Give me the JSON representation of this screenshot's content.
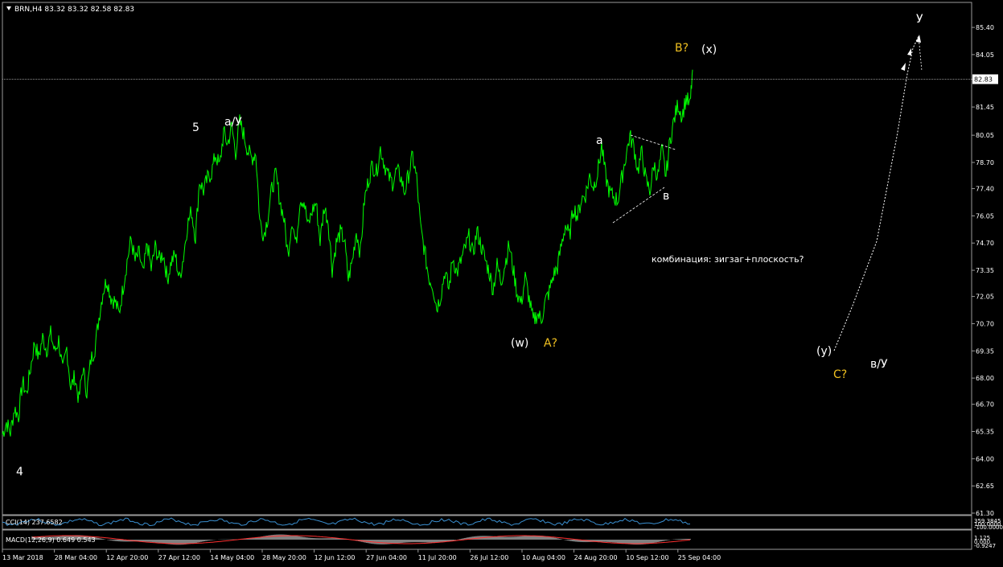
{
  "header": {
    "title": "BRN,H4  83.32 83.32 82.58 82.83",
    "arrow_icon": "triangle-down-icon"
  },
  "current_price": "82.83",
  "colors": {
    "background": "#000000",
    "price_line": "#00ff00",
    "text": "#ffffff",
    "accent_wave": "#f0c020",
    "grid_axis": "#aaaaaa",
    "macd_bar": "#aaaaaa",
    "macd_signal": "#ff3030",
    "cci_line": "#3a8fd0"
  },
  "chart_data": {
    "type": "line",
    "symbol": "BRN",
    "timeframe": "H4",
    "ylim": [
      61.3,
      86.6
    ],
    "y_ticks": [
      "85.40",
      "84.05",
      "82.83",
      "81.45",
      "80.05",
      "78.70",
      "77.40",
      "76.05",
      "74.70",
      "73.35",
      "72.05",
      "70.70",
      "69.35",
      "68.00",
      "66.70",
      "65.35",
      "64.00",
      "62.65",
      "61.30"
    ],
    "x_ticks": [
      "13 Mar 2018",
      "28 Mar 04:00",
      "12 Apr 20:00",
      "27 Apr 12:00",
      "14 May 04:00",
      "28 May 20:00",
      "12 Jun 12:00",
      "27 Jun 04:00",
      "11 Jul 20:00",
      "26 Jul 12:00",
      "10 Aug 04:00",
      "24 Aug 20:00",
      "10 Sep 12:00",
      "25 Sep 04:00"
    ],
    "series": [
      {
        "points": [
          [
            0,
            65.2
          ],
          [
            5,
            65.8
          ],
          [
            10,
            65.3
          ],
          [
            15,
            66.5
          ],
          [
            20,
            66.1
          ],
          [
            25,
            67.8
          ],
          [
            30,
            67.2
          ],
          [
            35,
            68.5
          ],
          [
            40,
            69.8
          ],
          [
            45,
            69.0
          ],
          [
            50,
            70.0
          ],
          [
            55,
            69.4
          ],
          [
            60,
            70.2
          ],
          [
            65,
            69.3
          ],
          [
            70,
            69.9
          ],
          [
            75,
            68.3
          ],
          [
            80,
            69.5
          ],
          [
            85,
            67.5
          ],
          [
            90,
            68.1
          ],
          [
            95,
            66.9
          ],
          [
            100,
            68.5
          ],
          [
            105,
            67.3
          ],
          [
            110,
            68.9
          ],
          [
            115,
            69.5
          ],
          [
            120,
            71.0
          ],
          [
            125,
            72.3
          ],
          [
            130,
            72.9
          ],
          [
            135,
            72.0
          ],
          [
            140,
            71.8
          ],
          [
            145,
            71.2
          ],
          [
            150,
            72.5
          ],
          [
            155,
            73.8
          ],
          [
            160,
            74.9
          ],
          [
            165,
            73.8
          ],
          [
            170,
            74.2
          ],
          [
            175,
            73.1
          ],
          [
            180,
            74.7
          ],
          [
            185,
            73.4
          ],
          [
            190,
            74.5
          ],
          [
            195,
            73.9
          ],
          [
            200,
            74.2
          ],
          [
            205,
            72.9
          ],
          [
            210,
            73.8
          ],
          [
            215,
            74.1
          ],
          [
            220,
            72.9
          ],
          [
            225,
            74.0
          ],
          [
            230,
            75.6
          ],
          [
            235,
            76.3
          ],
          [
            240,
            75.0
          ],
          [
            245,
            77.8
          ],
          [
            250,
            77.3
          ],
          [
            255,
            77.9
          ],
          [
            260,
            78.2
          ],
          [
            265,
            79.1
          ],
          [
            270,
            78.5
          ],
          [
            275,
            80.2
          ],
          [
            280,
            79.6
          ],
          [
            285,
            80.5
          ],
          [
            290,
            79.2
          ],
          [
            295,
            80.7
          ],
          [
            300,
            80.1
          ],
          [
            305,
            79.3
          ],
          [
            310,
            78.9
          ],
          [
            315,
            79.2
          ],
          [
            320,
            75.8
          ],
          [
            325,
            75.1
          ],
          [
            330,
            76.0
          ],
          [
            335,
            77.4
          ],
          [
            340,
            78.1
          ],
          [
            345,
            76.8
          ],
          [
            350,
            75.9
          ],
          [
            355,
            74.1
          ],
          [
            360,
            75.9
          ],
          [
            365,
            74.6
          ],
          [
            370,
            76.9
          ],
          [
            375,
            76.8
          ],
          [
            380,
            75.5
          ],
          [
            385,
            76.3
          ],
          [
            390,
            76.7
          ],
          [
            395,
            74.8
          ],
          [
            400,
            76.5
          ],
          [
            405,
            75.8
          ],
          [
            410,
            73.4
          ],
          [
            415,
            74.7
          ],
          [
            420,
            75.2
          ],
          [
            425,
            74.9
          ],
          [
            430,
            72.9
          ],
          [
            435,
            73.8
          ],
          [
            440,
            75.3
          ],
          [
            445,
            74.2
          ],
          [
            450,
            76.8
          ],
          [
            455,
            77.8
          ],
          [
            460,
            78.6
          ],
          [
            465,
            78.2
          ],
          [
            470,
            79.4
          ],
          [
            475,
            78.6
          ],
          [
            480,
            78.0
          ],
          [
            485,
            77.7
          ],
          [
            490,
            78.3
          ],
          [
            495,
            78.0
          ],
          [
            500,
            77.2
          ],
          [
            505,
            78.1
          ],
          [
            510,
            79.0
          ],
          [
            515,
            77.9
          ],
          [
            520,
            75.4
          ],
          [
            525,
            74.3
          ],
          [
            530,
            73.0
          ],
          [
            535,
            72.6
          ],
          [
            540,
            71.5
          ],
          [
            545,
            72.1
          ],
          [
            550,
            73.3
          ],
          [
            555,
            72.4
          ],
          [
            560,
            74.0
          ],
          [
            565,
            73.2
          ],
          [
            570,
            73.8
          ],
          [
            575,
            74.4
          ],
          [
            580,
            75.0
          ],
          [
            585,
            74.1
          ],
          [
            590,
            75.3
          ],
          [
            595,
            74.6
          ],
          [
            600,
            73.9
          ],
          [
            605,
            73.3
          ],
          [
            610,
            72.4
          ],
          [
            615,
            73.6
          ],
          [
            620,
            72.8
          ],
          [
            625,
            73.7
          ],
          [
            630,
            74.6
          ],
          [
            635,
            73.4
          ],
          [
            640,
            72.2
          ],
          [
            645,
            71.7
          ],
          [
            650,
            73.0
          ],
          [
            655,
            71.9
          ],
          [
            660,
            70.8
          ],
          [
            665,
            71.2
          ],
          [
            670,
            70.9
          ],
          [
            675,
            71.8
          ],
          [
            680,
            72.3
          ],
          [
            685,
            73.1
          ],
          [
            690,
            73.5
          ],
          [
            695,
            74.6
          ],
          [
            700,
            75.6
          ],
          [
            705,
            75.0
          ],
          [
            710,
            76.5
          ],
          [
            715,
            76.0
          ],
          [
            720,
            76.9
          ],
          [
            725,
            77.1
          ],
          [
            730,
            78.0
          ],
          [
            735,
            77.5
          ],
          [
            740,
            78.2
          ],
          [
            745,
            79.5
          ],
          [
            750,
            78.0
          ],
          [
            755,
            77.2
          ],
          [
            760,
            77.0
          ],
          [
            765,
            76.8
          ],
          [
            770,
            77.9
          ],
          [
            775,
            79.0
          ],
          [
            780,
            80.0
          ],
          [
            785,
            79.5
          ],
          [
            790,
            78.3
          ],
          [
            795,
            79.2
          ],
          [
            800,
            77.8
          ],
          [
            805,
            77.3
          ],
          [
            810,
            78.6
          ],
          [
            815,
            78.0
          ],
          [
            820,
            79.3
          ],
          [
            825,
            78.0
          ],
          [
            830,
            79.8
          ],
          [
            835,
            80.8
          ],
          [
            840,
            81.6
          ],
          [
            845,
            81.0
          ],
          [
            850,
            81.9
          ],
          [
            855,
            81.5
          ],
          [
            858,
            83.3
          ]
        ]
      }
    ],
    "annotations": [
      {
        "text": "4",
        "style": "white"
      },
      {
        "text": "5",
        "style": "white"
      },
      {
        "text": "a/У",
        "style": "white"
      },
      {
        "text": "а",
        "style": "white"
      },
      {
        "text": "в",
        "style": "white"
      },
      {
        "text": "B?",
        "style": "yellow"
      },
      {
        "text": "(x)",
        "style": "white"
      },
      {
        "text": "(w)",
        "style": "white"
      },
      {
        "text": "A?",
        "style": "yellow"
      },
      {
        "text": "(y)",
        "style": "white"
      },
      {
        "text": "C?",
        "style": "yellow"
      },
      {
        "text": "в/У",
        "style": "white"
      },
      {
        "text": "У",
        "style": "white"
      },
      {
        "text": "комбинация: зигзаг+плоскость?",
        "style": "white"
      }
    ]
  },
  "indicators": {
    "cci": {
      "label": "CCI(14) 237.6582",
      "scale_labels": [
        "359.3845",
        "100.0000",
        "-100.0000"
      ]
    },
    "macd": {
      "label": "MACD(12,26,9) 0.649 0.543",
      "scale_labels": [
        "1.125",
        "0.000",
        "-0.9247"
      ]
    }
  }
}
